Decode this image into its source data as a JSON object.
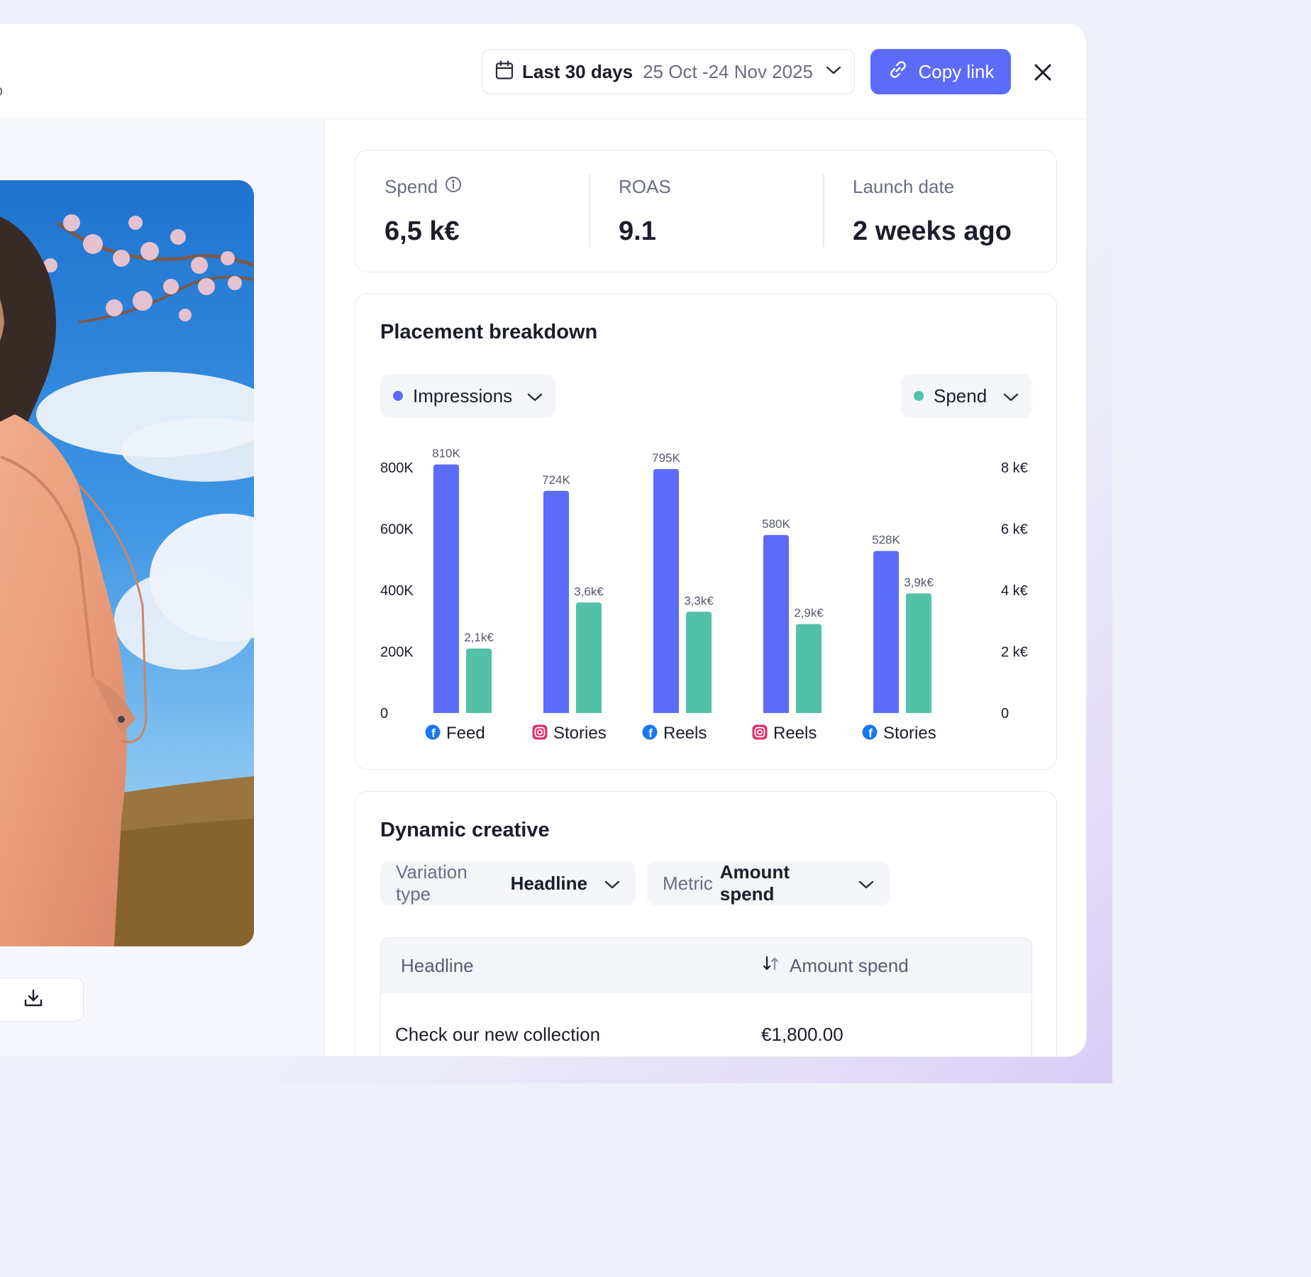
{
  "header": {
    "date_picker": {
      "label": "Last 30 days",
      "range": "25 Oct -24 Nov 2025"
    },
    "copy_link_label": "Copy link"
  },
  "stats": [
    {
      "label": "Spend",
      "value": "6,5 k€",
      "has_info": true
    },
    {
      "label": "ROAS",
      "value": "9.1",
      "has_info": false
    },
    {
      "label": "Launch date",
      "value": "2 weeks ago",
      "has_info": false
    }
  ],
  "placement": {
    "title": "Placement breakdown",
    "left_metric": {
      "label": "Impressions",
      "color": "#5b6cf9"
    },
    "right_metric": {
      "label": "Spend",
      "color": "#52c1a7"
    }
  },
  "chart_data": {
    "type": "bar",
    "categories": [
      "Feed",
      "Stories",
      "Reels",
      "Reels",
      "Stories"
    ],
    "category_platforms": [
      "facebook",
      "instagram",
      "facebook",
      "instagram",
      "facebook"
    ],
    "series": [
      {
        "name": "Impressions",
        "axis": "left",
        "color": "#5b6cf9",
        "values": [
          810000,
          724000,
          795000,
          580000,
          528000
        ],
        "labels": [
          "810K",
          "724K",
          "795K",
          "580K",
          "528K"
        ]
      },
      {
        "name": "Spend",
        "axis": "right",
        "color": "#52c1a7",
        "values": [
          2100,
          3600,
          3300,
          2900,
          3900
        ],
        "labels": [
          "2,1k€",
          "3,6k€",
          "3,3k€",
          "2,9k€",
          "3,9k€"
        ]
      }
    ],
    "left_ticks": [
      "0",
      "200K",
      "400K",
      "600K",
      "800K"
    ],
    "right_ticks": [
      "0",
      "2 k€",
      "4 k€",
      "6 k€",
      "8 k€"
    ],
    "ylim_left": [
      0,
      800000
    ],
    "ylim_right": [
      0,
      8000
    ],
    "grid": false
  },
  "dynamic": {
    "title": "Dynamic creative",
    "variation_key": "Variation type",
    "variation_value": "Headline",
    "metric_key": "Metric",
    "metric_value": "Amount spend",
    "table": {
      "col1": "Headline",
      "col2": "Amount spend",
      "rows": [
        {
          "headline": "Check our new collection",
          "amount": "€1,800.00"
        }
      ]
    }
  },
  "icons": {
    "calendar": "calendar-icon",
    "chevron": "chevron-down-icon",
    "link": "link-icon",
    "close": "close-icon",
    "info": "info-icon",
    "download": "download-icon",
    "sort": "sort-icon",
    "facebook": "facebook-icon",
    "instagram": "instagram-icon"
  }
}
